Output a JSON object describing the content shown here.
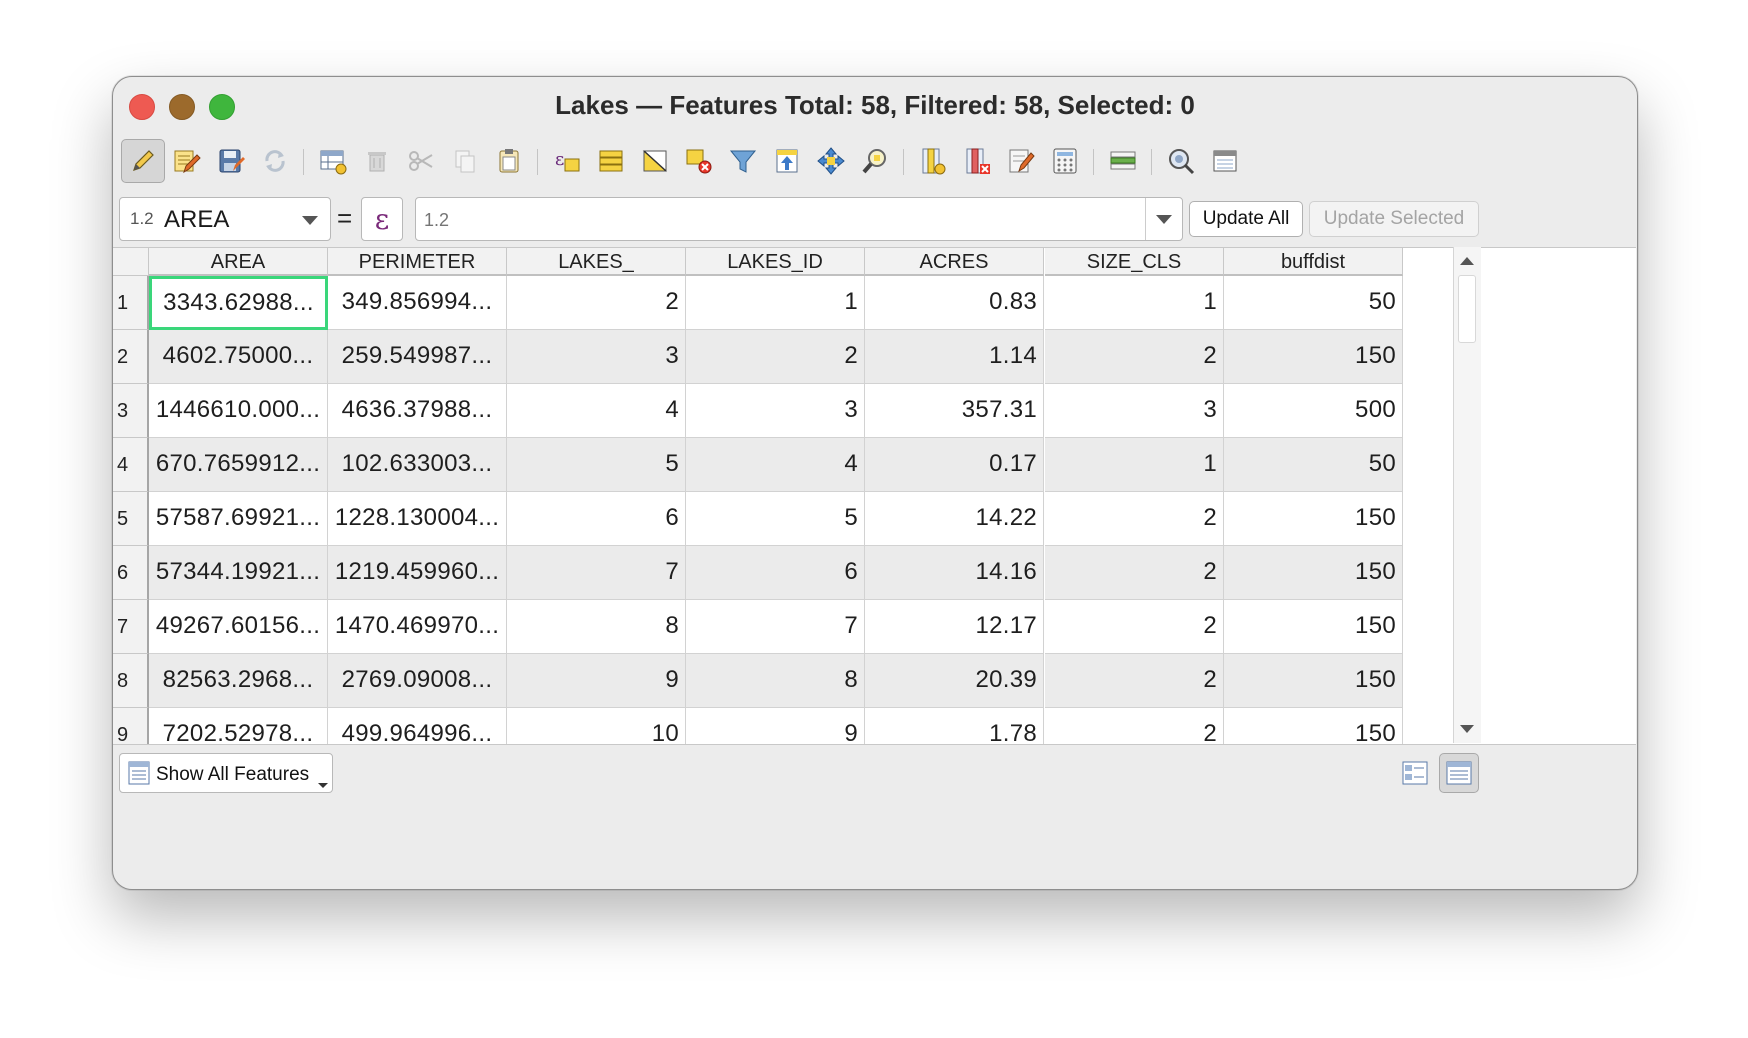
{
  "window": {
    "title": "Lakes — Features Total: 58, Filtered: 58, Selected: 0"
  },
  "toolbar": {
    "buttons": [
      {
        "icon": "pencil-edit-icon",
        "tooltip": "Toggle editing mode"
      },
      {
        "icon": "multi-edit-icon",
        "tooltip": "Toggle multi edit mode"
      },
      {
        "icon": "save-edits-icon",
        "tooltip": "Save edits"
      },
      {
        "icon": "reload-icon",
        "tooltip": "Reload the table"
      },
      {
        "icon": "add-feature-icon",
        "tooltip": "Add feature"
      },
      {
        "icon": "delete-selected-icon",
        "tooltip": "Delete selected features"
      },
      {
        "icon": "cut-icon",
        "tooltip": "Cut selected rows"
      },
      {
        "icon": "copy-icon",
        "tooltip": "Copy selected rows"
      },
      {
        "icon": "paste-icon",
        "tooltip": "Paste features"
      },
      {
        "icon": "select-by-expression-icon",
        "tooltip": "Select by expression"
      },
      {
        "icon": "select-all-icon",
        "tooltip": "Select all"
      },
      {
        "icon": "invert-selection-icon",
        "tooltip": "Invert selection"
      },
      {
        "icon": "deselect-all-icon",
        "tooltip": "Deselect all"
      },
      {
        "icon": "filter-icon",
        "tooltip": "Filter/Select features using form"
      },
      {
        "icon": "move-selection-top-icon",
        "tooltip": "Move selection to top"
      },
      {
        "icon": "pan-to-selected-icon",
        "tooltip": "Pan map to selected rows"
      },
      {
        "icon": "zoom-to-selected-icon",
        "tooltip": "Zoom map to selected rows"
      },
      {
        "icon": "new-field-icon",
        "tooltip": "New field"
      },
      {
        "icon": "delete-field-icon",
        "tooltip": "Delete field"
      },
      {
        "icon": "field-calculator-edit-icon",
        "tooltip": "Organize columns"
      },
      {
        "icon": "field-calculator-icon",
        "tooltip": "Open field calculator"
      },
      {
        "icon": "conditional-formatting-icon",
        "tooltip": "Conditional formatting"
      },
      {
        "icon": "actions-icon",
        "tooltip": "Actions"
      },
      {
        "icon": "dock-window-icon",
        "tooltip": "Dock attribute table"
      }
    ]
  },
  "field_calculator": {
    "field_type": "1.2",
    "field_name": "AREA",
    "equals": "=",
    "expression_symbol": "ε",
    "value_placeholder": "1.2",
    "update_all_label": "Update All",
    "update_selected_label": "Update Selected"
  },
  "table": {
    "columns": [
      "AREA",
      "PERIMETER",
      "LAKES_",
      "LAKES_ID",
      "ACRES",
      "SIZE_CLS",
      "buffdist"
    ],
    "rows": [
      {
        "n": "1",
        "cells": [
          "3343.62988...",
          "349.856994...",
          "2",
          "1",
          "0.83",
          "1",
          "50"
        ]
      },
      {
        "n": "2",
        "cells": [
          "4602.75000...",
          "259.549987...",
          "3",
          "2",
          "1.14",
          "2",
          "150"
        ]
      },
      {
        "n": "3",
        "cells": [
          "1446610.000...",
          "4636.37988...",
          "4",
          "3",
          "357.31",
          "3",
          "500"
        ]
      },
      {
        "n": "4",
        "cells": [
          "670.7659912...",
          "102.633003...",
          "5",
          "4",
          "0.17",
          "1",
          "50"
        ]
      },
      {
        "n": "5",
        "cells": [
          "57587.69921...",
          "1228.130004...",
          "6",
          "5",
          "14.22",
          "2",
          "150"
        ]
      },
      {
        "n": "6",
        "cells": [
          "57344.19921...",
          "1219.459960...",
          "7",
          "6",
          "14.16",
          "2",
          "150"
        ]
      },
      {
        "n": "7",
        "cells": [
          "49267.60156...",
          "1470.469970...",
          "8",
          "7",
          "12.17",
          "2",
          "150"
        ]
      },
      {
        "n": "8",
        "cells": [
          "82563.2968...",
          "2769.09008...",
          "9",
          "8",
          "20.39",
          "2",
          "150"
        ]
      },
      {
        "n": "9",
        "cells": [
          "7202.52978...",
          "499.964996...",
          "10",
          "9",
          "1.78",
          "2",
          "150"
        ]
      }
    ]
  },
  "footer": {
    "filter_label": "Show All Features"
  }
}
